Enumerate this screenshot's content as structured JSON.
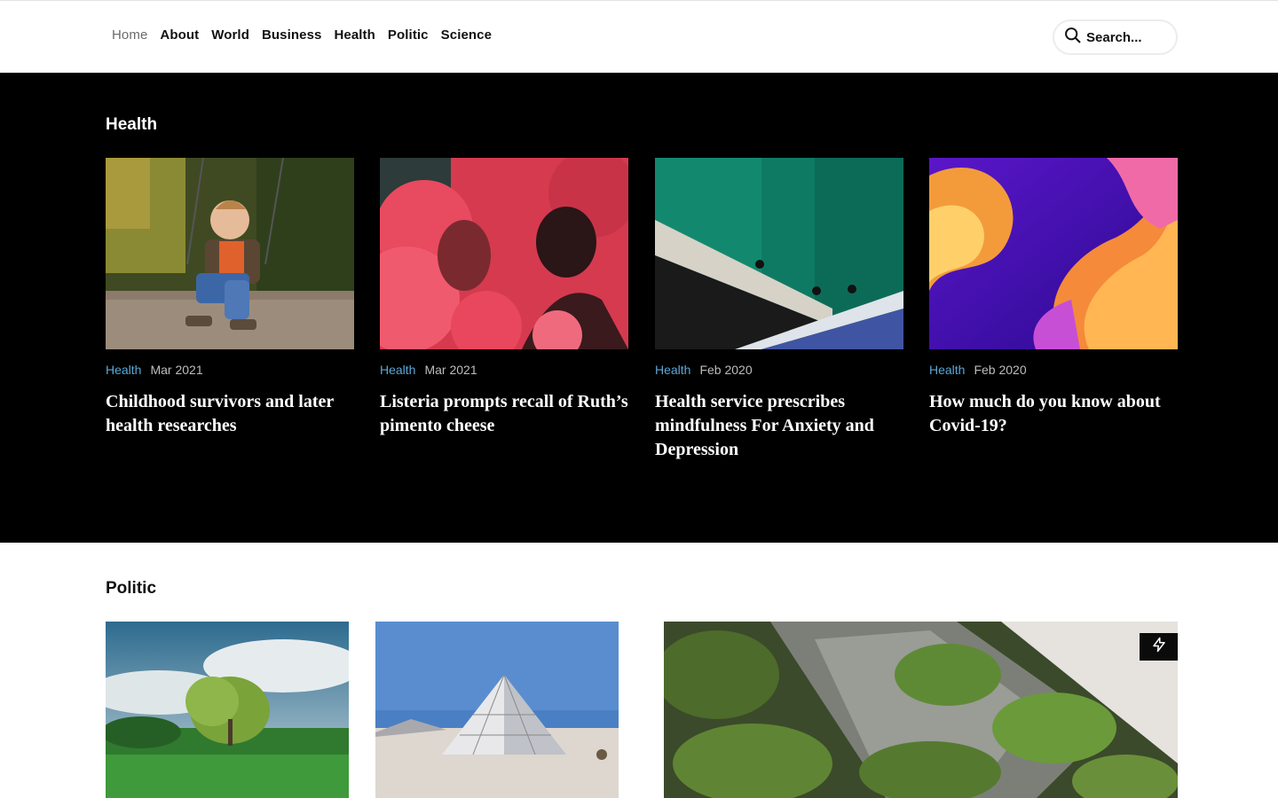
{
  "nav": {
    "items": [
      "Home",
      "About",
      "World",
      "Business",
      "Health",
      "Politic",
      "Science"
    ],
    "active": "Home"
  },
  "search": {
    "placeholder": "Search..."
  },
  "health": {
    "title": "Health",
    "articles": [
      {
        "category": "Health",
        "date": "Mar 2021",
        "title": "Childhood survivors and later health researches"
      },
      {
        "category": "Health",
        "date": "Mar 2021",
        "title": "Listeria prompts recall of Ruth’s pimento cheese"
      },
      {
        "category": "Health",
        "date": "Feb 2020",
        "title": "Health service prescribes mindfulness For Anxiety and Depression"
      },
      {
        "category": "Health",
        "date": "Feb 2020",
        "title": "How much do you know about Covid-19?"
      }
    ]
  },
  "politic": {
    "title": "Politic"
  },
  "colors": {
    "category": "#5aa7d6",
    "dark_band": "#000000",
    "muted_nav": "#6b6b6b"
  },
  "icons": {
    "search": "search-icon",
    "bolt": "lightning-icon"
  }
}
